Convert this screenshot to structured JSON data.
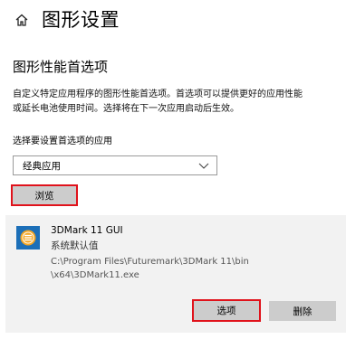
{
  "header": {
    "title": "图形设置"
  },
  "section": {
    "title": "图形性能首选项",
    "description_line1": "自定义特定应用程序的图形性能首选项。首选项可以提供更好的应用性能",
    "description_line2": "或延长电池使用时间。选择将在下一次应用启动后生效。"
  },
  "app_select": {
    "label": "选择要设置首选项的应用",
    "selected": "经典应用",
    "browse_label": "浏览"
  },
  "app_entry": {
    "name": "3DMark 11 GUI",
    "preference": "系统默认值",
    "path_line1": "C:\\Program Files\\Futuremark\\3DMark 11\\bin",
    "path_line2": "\\x64\\3DMark11.exe",
    "options_label": "选项",
    "delete_label": "删除"
  },
  "colors": {
    "highlight_border": "#e0121b",
    "button_bg": "#cccccc",
    "card_bg": "#f2f2f2",
    "app_icon_bg": "#1c6fb8",
    "app_icon_inner": "#f5a623"
  }
}
